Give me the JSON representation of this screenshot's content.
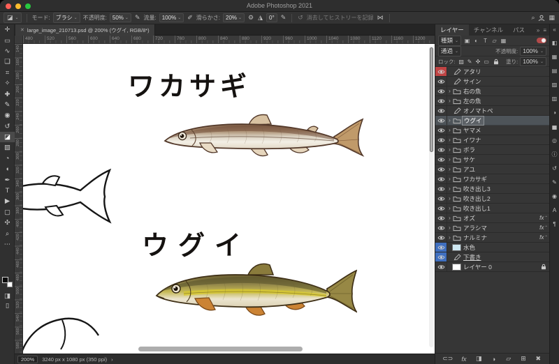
{
  "titlebar": {
    "title": "Adobe Photoshop 2021"
  },
  "options_bar": {
    "mode_label": "モード:",
    "mode_value": "ブラシ",
    "opacity_label": "不透明度:",
    "opacity_value": "50%",
    "flow_label": "流量:",
    "flow_value": "100%",
    "smoothing_label": "滑らかさ:",
    "smoothing_value": "20%",
    "angle_value": "0°",
    "history_option": "消去してヒストリーを記録"
  },
  "doc_tab": {
    "close_glyph": "✕",
    "title": "large_image_210713.psd @ 200% (ウグイ, RGB/8*)"
  },
  "rulers": {
    "horizontal": [
      "480",
      "520",
      "560",
      "600",
      "640",
      "680",
      "720",
      "760",
      "800",
      "840",
      "880",
      "920",
      "960",
      "1000",
      "1040",
      "1080",
      "1120",
      "1160",
      "1200"
    ],
    "vertical": [
      "140",
      "160",
      "180",
      "200",
      "220",
      "240",
      "260",
      "280",
      "300",
      "320",
      "340",
      "360",
      "380",
      "400",
      "420",
      "440",
      "460",
      "480",
      "500",
      "520",
      "540",
      "560",
      "580"
    ]
  },
  "canvas": {
    "labels": {
      "wakasagi": "ワカサギ",
      "ugui": "ウグイ"
    }
  },
  "toolbar": {
    "tools": [
      {
        "name": "move-tool",
        "glyph": "✛"
      },
      {
        "name": "marquee-tool",
        "glyph": "▭"
      },
      {
        "name": "lasso-tool",
        "glyph": "∿"
      },
      {
        "name": "object-selection-tool",
        "glyph": "❏"
      },
      {
        "name": "crop-tool",
        "glyph": "⌗"
      },
      {
        "name": "eyedropper-tool",
        "glyph": "✧"
      },
      {
        "name": "spot-healing-tool",
        "glyph": "✚"
      },
      {
        "name": "brush-tool",
        "glyph": "✎"
      },
      {
        "name": "clone-stamp-tool",
        "glyph": "◉"
      },
      {
        "name": "history-brush-tool",
        "glyph": "↺"
      },
      {
        "name": "eraser-tool",
        "glyph": "◪",
        "active": true
      },
      {
        "name": "gradient-tool",
        "glyph": "▧"
      },
      {
        "name": "blur-tool",
        "glyph": "◔"
      },
      {
        "name": "dodge-tool",
        "glyph": "◖"
      },
      {
        "name": "pen-tool",
        "glyph": "✒"
      },
      {
        "name": "type-tool",
        "glyph": "T"
      },
      {
        "name": "path-selection-tool",
        "glyph": "▶"
      },
      {
        "name": "shape-tool",
        "glyph": "▢"
      },
      {
        "name": "hand-tool",
        "glyph": "✣"
      },
      {
        "name": "zoom-tool",
        "glyph": "⌕"
      },
      {
        "name": "edit-toolbar-button",
        "glyph": "⋯"
      }
    ]
  },
  "layers_panel": {
    "tabs": [
      {
        "label": "レイヤー"
      },
      {
        "label": "チャンネル"
      },
      {
        "label": "パス"
      }
    ],
    "header": {
      "collapse_glyph": "»",
      "menu_glyph": "≡"
    },
    "filter": {
      "kind_label": "種類",
      "icons": [
        {
          "name": "filter-pixel-layers-icon",
          "glyph": "▣"
        },
        {
          "name": "filter-adjustment-layers-icon",
          "glyph": "◐"
        },
        {
          "name": "filter-type-layers-icon",
          "glyph": "T"
        },
        {
          "name": "filter-shape-layers-icon",
          "glyph": "▱"
        },
        {
          "name": "filter-smart-objects-icon",
          "glyph": "▦"
        }
      ]
    },
    "blend": {
      "mode": "通過",
      "opacity_label": "不透明度:",
      "opacity_value": "100%"
    },
    "lock": {
      "label": "ロック:",
      "icons": [
        {
          "name": "lock-transparent-pixels-icon",
          "glyph": "▨"
        },
        {
          "name": "lock-image-pixels-icon",
          "glyph": "✎"
        },
        {
          "name": "lock-position-icon",
          "glyph": "✜"
        },
        {
          "name": "lock-artboard-icon",
          "glyph": "▭"
        }
      ],
      "fill_label": "塗り:",
      "fill_value": "100%"
    },
    "fx_badge_label": "fx",
    "layers": [
      {
        "name": "アタリ",
        "kind": "paint",
        "label": "red"
      },
      {
        "name": "サイン",
        "kind": "paint"
      },
      {
        "name": "右の魚",
        "kind": "folder",
        "chevron": true
      },
      {
        "name": "左の魚",
        "kind": "folder",
        "chevron": true
      },
      {
        "name": "オノマトペ",
        "kind": "paint"
      },
      {
        "name": "ウグイ",
        "kind": "folder",
        "chevron": true,
        "selected": true
      },
      {
        "name": "ヤマメ",
        "kind": "folder",
        "chevron": true
      },
      {
        "name": "イワナ",
        "kind": "folder",
        "chevron": true
      },
      {
        "name": "ボラ",
        "kind": "folder",
        "chevron": true
      },
      {
        "name": "サケ",
        "kind": "folder",
        "chevron": true
      },
      {
        "name": "アユ",
        "kind": "folder",
        "chevron": true
      },
      {
        "name": "ワカサギ",
        "kind": "folder",
        "chevron": true
      },
      {
        "name": "吹き出し3",
        "kind": "folder",
        "chevron": true
      },
      {
        "name": "吹き出し2",
        "kind": "folder",
        "chevron": true
      },
      {
        "name": "吹き出し1",
        "kind": "folder",
        "chevron": true
      },
      {
        "name": "オズ",
        "kind": "folder",
        "chevron": true,
        "fx": true
      },
      {
        "name": "アラシマ",
        "kind": "folder",
        "chevron": true,
        "fx": true
      },
      {
        "name": "ナルミナ",
        "kind": "folder",
        "chevron": true,
        "fx": true
      },
      {
        "name": "水色",
        "kind": "thumb",
        "label": "blue",
        "thumb_color": "#cfe8f2"
      },
      {
        "name": "下書き",
        "kind": "paint",
        "label": "blue",
        "underline": true
      },
      {
        "name": "レイヤー 0",
        "kind": "thumb",
        "thumb_color": "#ffffff",
        "locked": true
      }
    ],
    "footer_icons": [
      {
        "name": "link-layers-icon",
        "glyph": "⊂⊃"
      },
      {
        "name": "layer-effects-icon",
        "glyph": "fx"
      },
      {
        "name": "add-layer-mask-icon",
        "glyph": "◨"
      },
      {
        "name": "new-adjustment-layer-icon",
        "glyph": "◑"
      },
      {
        "name": "new-group-icon",
        "glyph": "▱"
      },
      {
        "name": "new-layer-icon",
        "glyph": "⊞"
      },
      {
        "name": "delete-layer-icon",
        "glyph": "✖"
      }
    ]
  },
  "right_dock": {
    "expand_glyph": "«",
    "icons": [
      {
        "name": "color-panel-icon",
        "glyph": "◧"
      },
      {
        "name": "swatches-panel-icon",
        "glyph": "▦"
      },
      {
        "name": "gradients-panel-icon",
        "glyph": "▤"
      },
      {
        "name": "patterns-panel-icon",
        "glyph": "▨"
      },
      {
        "name": "libraries-panel-icon",
        "glyph": "▥"
      },
      {
        "name": "adjustments-panel-icon",
        "glyph": "◑"
      },
      {
        "name": "histogram-panel-icon",
        "glyph": "▅"
      },
      {
        "name": "navigator-panel-icon",
        "glyph": "◎"
      },
      {
        "name": "info-panel-icon",
        "glyph": "ⓘ"
      },
      {
        "name": "history-panel-icon",
        "glyph": "↺"
      },
      {
        "name": "brushes-panel-icon",
        "glyph": "✎"
      },
      {
        "name": "clone-source-panel-icon",
        "glyph": "◉"
      },
      {
        "name": "character-panel-icon",
        "glyph": "A"
      },
      {
        "name": "paragraph-panel-icon",
        "glyph": "¶"
      }
    ]
  },
  "status_bar": {
    "zoom": "200%",
    "doc_info": "3240 px x 1080 px (350 ppi)",
    "chevron_glyph": "›"
  }
}
